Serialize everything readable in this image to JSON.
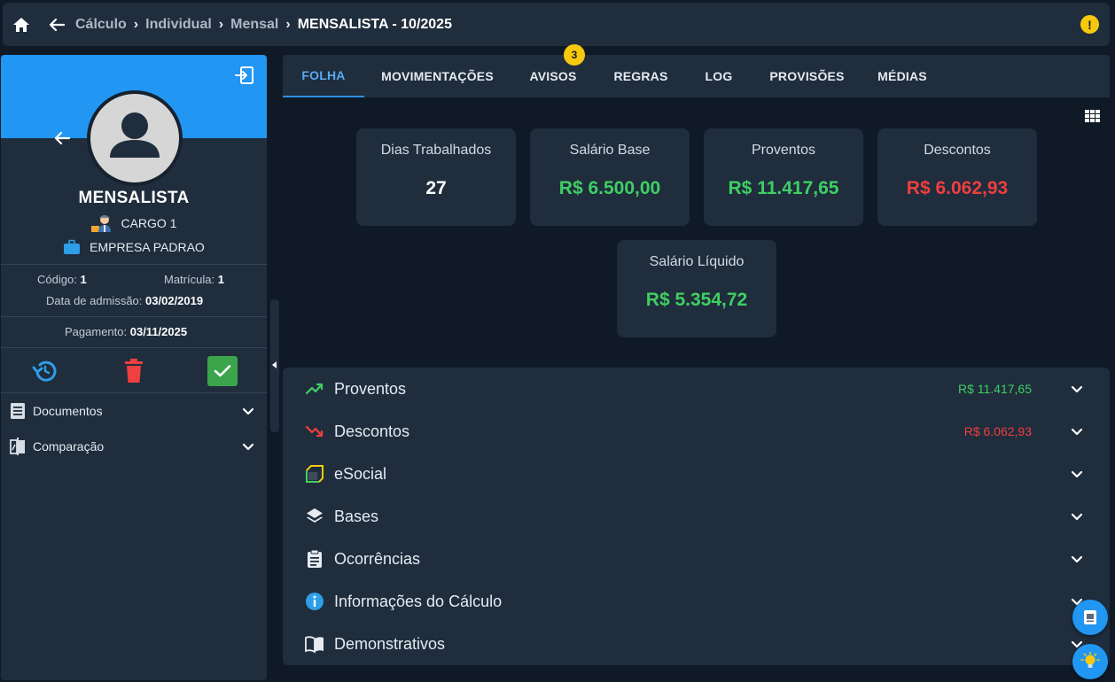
{
  "breadcrumb": {
    "items": [
      "Cálculo",
      "Individual",
      "Mensal"
    ],
    "current": "MENSALISTA - 10/2025"
  },
  "warning": {
    "glyph": "!",
    "icon": "warning-icon",
    "color": "#f6c90e"
  },
  "employee": {
    "name": "MENSALISTA",
    "role": "CARGO 1",
    "company": "EMPRESA PADRAO",
    "codigo_label": "Código:",
    "codigo": "1",
    "matricula_label": "Matrícula:",
    "matricula": "1",
    "admissao_label": "Data de admissão:",
    "admissao": "03/02/2019",
    "pagamento_label": "Pagamento:",
    "pagamento": "03/11/2025"
  },
  "side_menu": [
    {
      "label": "Documentos",
      "icon": "document-icon"
    },
    {
      "label": "Comparação",
      "icon": "compare-icon"
    }
  ],
  "tabs": [
    {
      "label": "FOLHA",
      "active": true
    },
    {
      "label": "MOVIMENTAÇÕES"
    },
    {
      "label": "AVISOS",
      "badge": "3"
    },
    {
      "label": "REGRAS"
    },
    {
      "label": "LOG"
    },
    {
      "label": "PROVISÕES"
    },
    {
      "label": "MÉDIAS"
    }
  ],
  "cards": [
    {
      "label": "Dias Trabalhados",
      "value": "27"
    },
    {
      "label": "Salário Base",
      "value": "R$ 6.500,00"
    },
    {
      "label": "Proventos",
      "value": "R$ 11.417,65"
    },
    {
      "label": "Descontos",
      "value": "R$ 6.062,93"
    },
    {
      "label": "Salário Líquido",
      "value": "R$ 5.354,72"
    }
  ],
  "sections": [
    {
      "title": "Proventos",
      "value": "R$ 11.417,65",
      "icon": "trending-up-icon"
    },
    {
      "title": "Descontos",
      "value": "R$ 6.062,93",
      "icon": "trending-down-icon"
    },
    {
      "title": "eSocial",
      "icon": "esocial-icon"
    },
    {
      "title": "Bases",
      "icon": "layers-icon"
    },
    {
      "title": "Ocorrências",
      "icon": "clipboard-icon"
    },
    {
      "title": "Informações do Cálculo",
      "icon": "info-icon"
    },
    {
      "title": "Demonstrativos",
      "icon": "book-icon"
    }
  ],
  "colors": {
    "accent": "#2196f3",
    "positive": "#3fcf63",
    "negative": "#ef3f3f",
    "badge": "#f6c90e"
  }
}
